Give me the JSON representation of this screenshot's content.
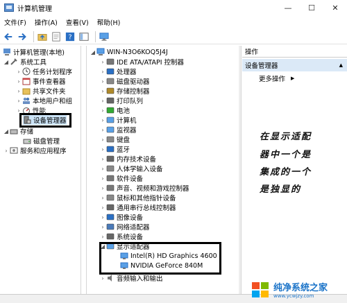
{
  "window": {
    "title": "计算机管理",
    "minimize": "—",
    "maximize": "☐",
    "close": "✕"
  },
  "menu": [
    "文件(F)",
    "操作(A)",
    "查看(V)",
    "帮助(H)"
  ],
  "left_tree": {
    "root": "计算机管理(本地)",
    "system_tools": "系统工具",
    "task_scheduler": "任务计划程序",
    "event_viewer": "事件查看器",
    "shared_folders": "共享文件夹",
    "local_users": "本地用户和组",
    "performance": "性能",
    "device_manager": "设备管理器",
    "storage": "存储",
    "disk_management": "磁盘管理",
    "services": "服务和应用程序"
  },
  "device_tree": {
    "computer": "WIN-N3O6KOQ5J4J",
    "categories": [
      "IDE ATA/ATAPI 控制器",
      "处理器",
      "磁盘驱动器",
      "存储控制器",
      "打印队列",
      "电池",
      "计算机",
      "监视器",
      "键盘",
      "蓝牙",
      "内存技术设备",
      "人体学输入设备",
      "软件设备",
      "声音、视频和游戏控制器",
      "鼠标和其他指针设备",
      "通用串行总线控制器",
      "图像设备",
      "网络适配器",
      "系统设备",
      "显示适配器"
    ],
    "display_adapters": [
      "Intel(R) HD Graphics 4600",
      "NVIDIA GeForce 840M"
    ],
    "last": "音频输入和输出"
  },
  "actions": {
    "header": "操作",
    "section": "设备管理器",
    "more": "更多操作"
  },
  "annotation": [
    "在显示适配",
    "器中一个是",
    "集成的一个",
    "是独显的"
  ],
  "watermark": {
    "title": "纯净系统之家",
    "url": "www.ycwjzy.com"
  }
}
